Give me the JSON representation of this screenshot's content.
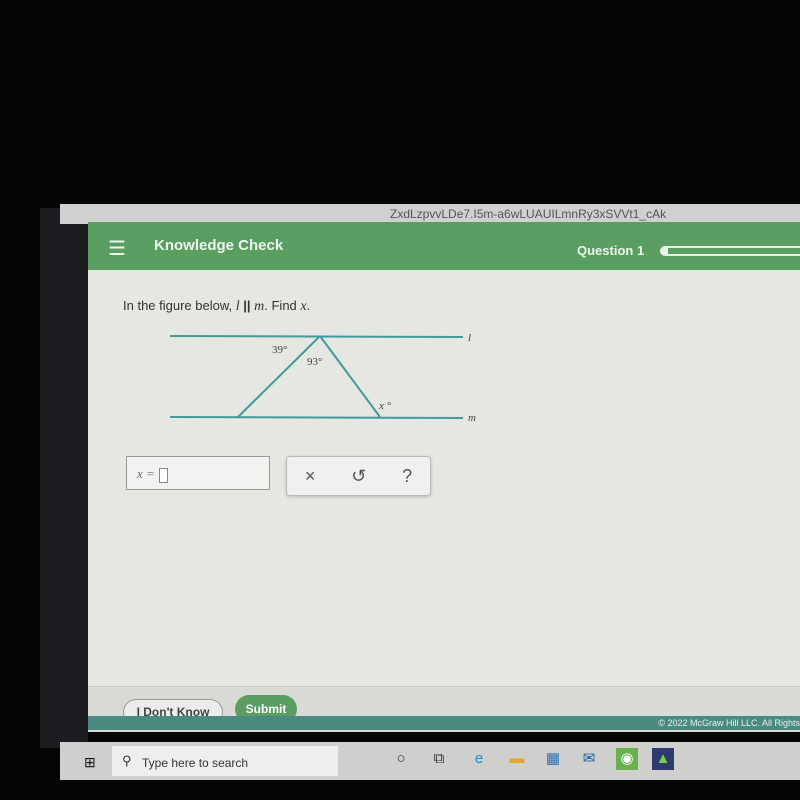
{
  "browser": {
    "url_fragment": "ZxdLzpvvLDe7.I5m-a6wLUAUILmnRy3xSVVt1_cAk"
  },
  "header": {
    "menu_icon": "hamburger-icon",
    "title": "Knowledge Check",
    "question_label": "Question 1",
    "progress": 0.04,
    "color": "#5a9e62"
  },
  "question": {
    "prefix": "In the figure below, ",
    "line1": "l",
    "parallel": " || ",
    "line2": "m",
    "mid": ". Find ",
    "var": "x",
    "suffix": ".",
    "figure": {
      "angle_a": "39°",
      "angle_b": "93°",
      "angle_x": "x °",
      "label_l": "l",
      "label_m": "m"
    }
  },
  "answer": {
    "label": "x =",
    "value": ""
  },
  "tools": {
    "clear": "×",
    "undo": "↺",
    "help": "?"
  },
  "footer": {
    "dont_know": "I Don't Know",
    "submit": "Submit",
    "copyright": "© 2022 McGraw Hill LLC. All Rights"
  },
  "taskbar": {
    "search_placeholder": "Type here to search"
  }
}
